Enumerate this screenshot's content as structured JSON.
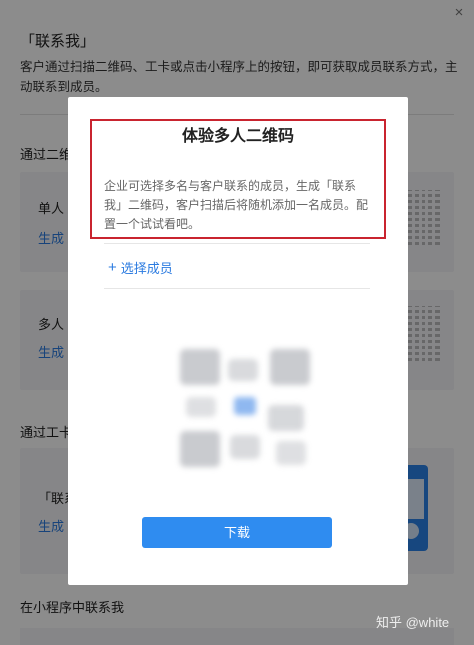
{
  "background": {
    "close_label": "×",
    "title": "「联系我」",
    "description": "客户通过扫描二维码、工卡或点击小程序上的按钮，即可获取成员联系方式，主动联系到成员。",
    "section_qr": {
      "title": "通过二维码",
      "cards": [
        {
          "title": "单人",
          "link": "生成"
        },
        {
          "title": "多人",
          "link": "生成"
        }
      ]
    },
    "section_badge": {
      "title": "通过工卡",
      "card": {
        "title": "「联系",
        "link": "生成"
      }
    },
    "section_miniprogram": {
      "title": "在小程序中联系我"
    }
  },
  "modal": {
    "title": "体验多人二维码",
    "description": "企业可选择多名与客户联系的成员，生成「联系我」二维码，客户扫描后将随机添加一名成员。配置一个试试看吧。",
    "select_member_label": "选择成员",
    "download_label": "下载"
  },
  "watermark": "知乎 @white",
  "colors": {
    "accent": "#2f8cf0",
    "link": "#2b7be0",
    "highlight_border": "#c9242f",
    "overlay": "rgba(0,0,0,0.45)"
  },
  "icons": {
    "close": "close-icon",
    "plus": "plus-icon"
  }
}
